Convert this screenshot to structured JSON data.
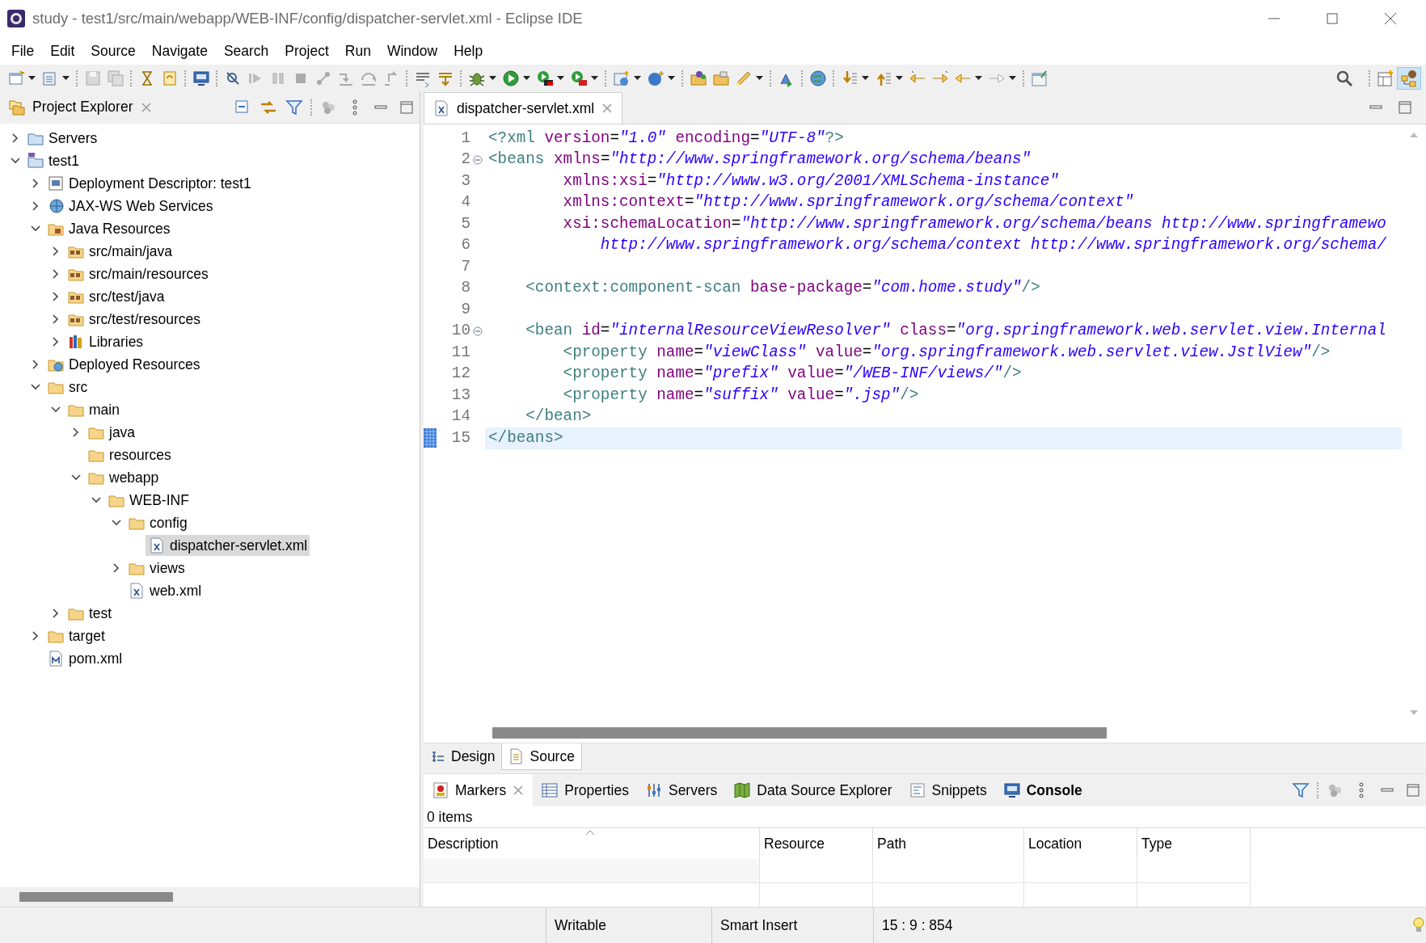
{
  "window": {
    "title": "study - test1/src/main/webapp/WEB-INF/config/dispatcher-servlet.xml - Eclipse IDE"
  },
  "menu": [
    "File",
    "Edit",
    "Source",
    "Navigate",
    "Search",
    "Project",
    "Run",
    "Window",
    "Help"
  ],
  "project_explorer": {
    "title": "Project Explorer",
    "tree": [
      {
        "label": "Servers",
        "kind": "server-folder",
        "expanded": false,
        "selected": false
      },
      {
        "label": "test1",
        "kind": "project",
        "expanded": true,
        "selected": false,
        "children": [
          {
            "label": "Deployment Descriptor: test1",
            "kind": "descriptor",
            "expanded": false,
            "selected": false
          },
          {
            "label": "JAX-WS Web Services",
            "kind": "webservice",
            "expanded": false,
            "selected": false
          },
          {
            "label": "Java Resources",
            "kind": "java-resources",
            "expanded": true,
            "selected": false,
            "children": [
              {
                "label": "src/main/java",
                "kind": "source-folder",
                "expanded": false,
                "selected": false
              },
              {
                "label": "src/main/resources",
                "kind": "source-folder",
                "expanded": false,
                "selected": false
              },
              {
                "label": "src/test/java",
                "kind": "source-folder",
                "expanded": false,
                "selected": false
              },
              {
                "label": "src/test/resources",
                "kind": "source-folder",
                "expanded": false,
                "selected": false
              },
              {
                "label": "Libraries",
                "kind": "libraries",
                "expanded": false,
                "selected": false
              }
            ]
          },
          {
            "label": "Deployed Resources",
            "kind": "deployed",
            "expanded": false,
            "selected": false
          },
          {
            "label": "src",
            "kind": "folder",
            "expanded": true,
            "selected": false,
            "children": [
              {
                "label": "main",
                "kind": "folder",
                "expanded": true,
                "selected": false,
                "children": [
                  {
                    "label": "java",
                    "kind": "folder",
                    "expanded": false,
                    "selected": false
                  },
                  {
                    "label": "resources",
                    "kind": "folder",
                    "selected": false
                  },
                  {
                    "label": "webapp",
                    "kind": "folder",
                    "expanded": true,
                    "selected": false,
                    "children": [
                      {
                        "label": "WEB-INF",
                        "kind": "folder",
                        "expanded": true,
                        "selected": false,
                        "children": [
                          {
                            "label": "config",
                            "kind": "folder",
                            "expanded": true,
                            "selected": false,
                            "children": [
                              {
                                "label": "dispatcher-servlet.xml",
                                "kind": "xml",
                                "selected": true
                              }
                            ]
                          },
                          {
                            "label": "views",
                            "kind": "folder",
                            "expanded": false,
                            "selected": false
                          },
                          {
                            "label": "web.xml",
                            "kind": "xml",
                            "selected": false
                          }
                        ]
                      }
                    ]
                  }
                ]
              },
              {
                "label": "test",
                "kind": "folder",
                "expanded": false,
                "selected": false
              }
            ]
          },
          {
            "label": "target",
            "kind": "folder",
            "expanded": false,
            "selected": false
          },
          {
            "label": "pom.xml",
            "kind": "maven",
            "selected": false
          }
        ]
      }
    ]
  },
  "editor": {
    "tabs": [
      {
        "label": "dispatcher-servlet.xml",
        "selected": true
      }
    ],
    "lines": [
      {
        "number": "1",
        "foldable": false,
        "current": false,
        "tokens": [
          {
            "kind": "tag",
            "text": "<?xml"
          },
          {
            "kind": "attr",
            "text": " version"
          },
          {
            "kind": "plain",
            "text": "="
          },
          {
            "kind": "value",
            "text": "\"1.0\""
          },
          {
            "kind": "attr",
            "text": " encoding"
          },
          {
            "kind": "plain",
            "text": "="
          },
          {
            "kind": "value",
            "text": "\"UTF-8\""
          },
          {
            "kind": "tag",
            "text": "?>"
          }
        ]
      },
      {
        "number": "2",
        "foldable": true,
        "current": false,
        "tokens": [
          {
            "kind": "tag",
            "text": "<beans"
          },
          {
            "kind": "attr",
            "text": " xmlns"
          },
          {
            "kind": "plain",
            "text": "="
          },
          {
            "kind": "value",
            "text": "\"http://www.springframework.org/schema/beans\""
          }
        ]
      },
      {
        "number": "3",
        "foldable": false,
        "current": false,
        "tokens": [
          {
            "kind": "attr",
            "text": "        xmlns:xsi"
          },
          {
            "kind": "plain",
            "text": "="
          },
          {
            "kind": "value",
            "text": "\"http://www.w3.org/2001/XMLSchema-instance\""
          }
        ]
      },
      {
        "number": "4",
        "foldable": false,
        "current": false,
        "tokens": [
          {
            "kind": "attr",
            "text": "        xmlns:context"
          },
          {
            "kind": "plain",
            "text": "="
          },
          {
            "kind": "value",
            "text": "\"http://www.springframework.org/schema/context\""
          }
        ]
      },
      {
        "number": "5",
        "foldable": false,
        "current": false,
        "tokens": [
          {
            "kind": "attr",
            "text": "        xsi:schemaLocation"
          },
          {
            "kind": "plain",
            "text": "="
          },
          {
            "kind": "value",
            "text": "\"http://www.springframework.org/schema/beans http://www.springframewo"
          }
        ]
      },
      {
        "number": "6",
        "foldable": false,
        "current": false,
        "tokens": [
          {
            "kind": "value",
            "text": "            http://www.springframework.org/schema/context http://www.springframework.org/schema/"
          }
        ]
      },
      {
        "number": "7",
        "foldable": false,
        "current": false
      },
      {
        "number": "8",
        "foldable": false,
        "current": false,
        "tokens": [
          {
            "kind": "tag",
            "text": "    <context:component-scan"
          },
          {
            "kind": "attr",
            "text": " base-package"
          },
          {
            "kind": "plain",
            "text": "="
          },
          {
            "kind": "value",
            "text": "\"com.home.study\""
          },
          {
            "kind": "tag",
            "text": "/>"
          }
        ]
      },
      {
        "number": "9",
        "foldable": false,
        "current": false
      },
      {
        "number": "10",
        "foldable": true,
        "current": false,
        "tokens": [
          {
            "kind": "tag",
            "text": "    <bean"
          },
          {
            "kind": "attr",
            "text": " id"
          },
          {
            "kind": "plain",
            "text": "="
          },
          {
            "kind": "value",
            "text": "\"internalResourceViewResolver\""
          },
          {
            "kind": "attr",
            "text": " class"
          },
          {
            "kind": "plain",
            "text": "="
          },
          {
            "kind": "value",
            "text": "\"org.springframework.web.servlet.view.Internal"
          }
        ]
      },
      {
        "number": "11",
        "foldable": false,
        "current": false,
        "tokens": [
          {
            "kind": "tag",
            "text": "        <property"
          },
          {
            "kind": "attr",
            "text": " name"
          },
          {
            "kind": "plain",
            "text": "="
          },
          {
            "kind": "value",
            "text": "\"viewClass\""
          },
          {
            "kind": "attr",
            "text": " value"
          },
          {
            "kind": "plain",
            "text": "="
          },
          {
            "kind": "value",
            "text": "\"org.springframework.web.servlet.view.JstlView\""
          },
          {
            "kind": "tag",
            "text": "/>"
          }
        ]
      },
      {
        "number": "12",
        "foldable": false,
        "current": false,
        "tokens": [
          {
            "kind": "tag",
            "text": "        <property"
          },
          {
            "kind": "attr",
            "text": " name"
          },
          {
            "kind": "plain",
            "text": "="
          },
          {
            "kind": "value",
            "text": "\"prefix\""
          },
          {
            "kind": "attr",
            "text": " value"
          },
          {
            "kind": "plain",
            "text": "="
          },
          {
            "kind": "value",
            "text": "\"/WEB-INF/views/\""
          },
          {
            "kind": "tag",
            "text": "/>"
          }
        ]
      },
      {
        "number": "13",
        "foldable": false,
        "current": false,
        "tokens": [
          {
            "kind": "tag",
            "text": "        <property"
          },
          {
            "kind": "attr",
            "text": " name"
          },
          {
            "kind": "plain",
            "text": "="
          },
          {
            "kind": "value",
            "text": "\"suffix\""
          },
          {
            "kind": "attr",
            "text": " value"
          },
          {
            "kind": "plain",
            "text": "="
          },
          {
            "kind": "value",
            "text": "\".jsp\""
          },
          {
            "kind": "tag",
            "text": "/>"
          }
        ]
      },
      {
        "number": "14",
        "foldable": false,
        "current": false,
        "tokens": [
          {
            "kind": "tag",
            "text": "    </bean>"
          }
        ]
      },
      {
        "number": "15",
        "foldable": false,
        "current": true,
        "tokens": [
          {
            "kind": "tag",
            "text": "</beans>"
          }
        ]
      }
    ],
    "mode_tabs": [
      {
        "label": "Design",
        "kind": "design",
        "selected": false
      },
      {
        "label": "Source",
        "kind": "source",
        "selected": true
      }
    ]
  },
  "bottom_panel": {
    "tabs": [
      {
        "label": "Markers",
        "kind": "markers",
        "selected": true,
        "bold": false
      },
      {
        "label": "Properties",
        "kind": "properties",
        "selected": false,
        "bold": false
      },
      {
        "label": "Servers",
        "kind": "servers",
        "selected": false,
        "bold": false
      },
      {
        "label": "Data Source Explorer",
        "kind": "datasource",
        "selected": false,
        "bold": false
      },
      {
        "label": "Snippets",
        "kind": "snippets",
        "selected": false,
        "bold": false
      },
      {
        "label": "Console",
        "kind": "console",
        "selected": false,
        "bold": true
      }
    ],
    "summary": "0 items",
    "table": {
      "columns": [
        "Description",
        "Resource",
        "Path",
        "Location",
        "Type"
      ]
    }
  },
  "status_bar": {
    "mode": "Writable",
    "insert": "Smart Insert",
    "position": "15 : 9 : 854"
  }
}
